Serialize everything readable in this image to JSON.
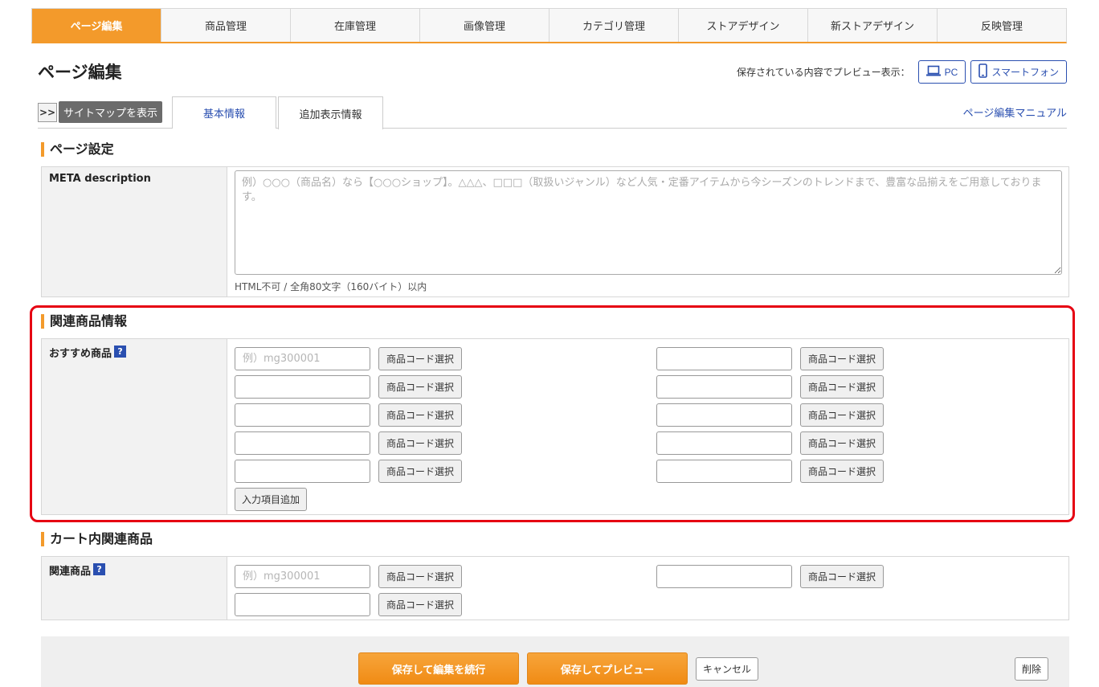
{
  "nav": {
    "items": [
      {
        "label": "ページ編集",
        "active": true
      },
      {
        "label": "商品管理"
      },
      {
        "label": "在庫管理"
      },
      {
        "label": "画像管理"
      },
      {
        "label": "カテゴリ管理"
      },
      {
        "label": "ストアデザイン"
      },
      {
        "label": "新ストアデザイン"
      },
      {
        "label": "反映管理"
      }
    ]
  },
  "page": {
    "title": "ページ編集"
  },
  "preview": {
    "label": "保存されている内容でプレビュー表示：",
    "pc": "PC",
    "smartphone": "スマートフォン"
  },
  "tabs": {
    "sitemap_arrow": ">>",
    "sitemap_label": "サイトマップを表示",
    "basic": "基本情報",
    "extra": "追加表示情報",
    "manual": "ページ編集マニュアル"
  },
  "page_settings": {
    "heading": "ページ設定",
    "meta_label": "META description",
    "meta_placeholder": "例）○○○（商品名）なら【○○○ショップ】。△△△、□□□（取扱いジャンル）など人気・定番アイテムから今シーズンのトレンドまで、豊富な品揃えをご用意しております。",
    "meta_note": "HTML不可 / 全角80文字（160バイト）以内"
  },
  "related": {
    "heading": "関連商品情報",
    "label": "おすすめ商品",
    "help": "?",
    "placeholder": "例）mg300001",
    "select_label": "商品コード選択",
    "add_label": "入力項目追加"
  },
  "cart": {
    "heading": "カート内関連商品",
    "label": "関連商品",
    "help": "?",
    "placeholder": "例）mg300001",
    "select_label": "商品コード選択"
  },
  "footer": {
    "save_continue": "保存して編集を続行",
    "save_preview": "保存してプレビュー",
    "cancel": "キャンセル",
    "delete": "削除"
  },
  "colors": {
    "accent": "#f39a2b",
    "link": "#2a4fb0",
    "highlight": "#e60012"
  }
}
